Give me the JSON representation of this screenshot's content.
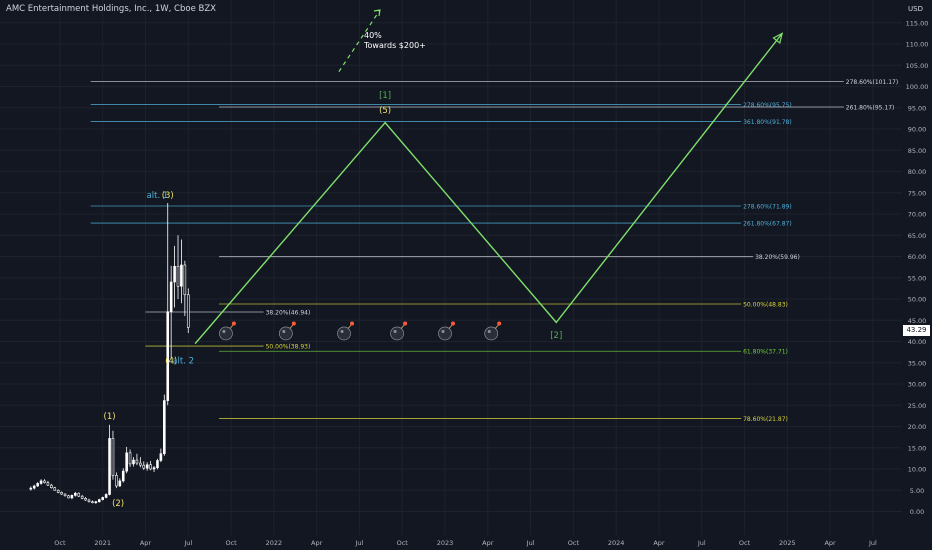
{
  "title": "AMC Entertainment Holdings, Inc., 1W, Cboe BZX",
  "currency": "USD",
  "last_price": "43.29",
  "annotation_lines": [
    "40%",
    "Towards $200+"
  ],
  "colors": {
    "background": "#131722",
    "grid": "#1e222d",
    "up": "#ffffff",
    "down": "#ffffff",
    "projection": "#7ee06a",
    "fib_cyan": "#4fb0d8",
    "fib_yellow": "#d6d43a",
    "fib_green": "#6fcf3a",
    "fib_white": "#d1d4dc",
    "wave_label": "#f0e36a",
    "alt_label": "#4fb0d8",
    "wave_bracket": "#54b054"
  },
  "chart_data": {
    "type": "candlestick",
    "title": "AMC Entertainment Holdings, Inc., 1W, Cboe BZX",
    "xlabel": "",
    "ylabel": "",
    "ylim": [
      -2,
      120
    ],
    "y_ticks": [
      "0.00",
      "5.00",
      "10.00",
      "15.00",
      "20.00",
      "25.00",
      "30.00",
      "35.00",
      "40.00",
      "45.00",
      "50.00",
      "55.00",
      "60.00",
      "65.00",
      "70.00",
      "75.00",
      "80.00",
      "85.00",
      "90.00",
      "95.00",
      "100.00",
      "105.00",
      "110.00",
      "115.00"
    ],
    "x_ticks": [
      {
        "label": "Oct",
        "t": 2020.75
      },
      {
        "label": "2021",
        "t": 2021.0
      },
      {
        "label": "Apr",
        "t": 2021.25
      },
      {
        "label": "Jul",
        "t": 2021.5
      },
      {
        "label": "Oct",
        "t": 2021.75
      },
      {
        "label": "2022",
        "t": 2022.0
      },
      {
        "label": "Apr",
        "t": 2022.25
      },
      {
        "label": "Jul",
        "t": 2022.5
      },
      {
        "label": "Oct",
        "t": 2022.75
      },
      {
        "label": "2023",
        "t": 2023.0
      },
      {
        "label": "Apr",
        "t": 2023.25
      },
      {
        "label": "Jul",
        "t": 2023.5
      },
      {
        "label": "Oct",
        "t": 2023.75
      },
      {
        "label": "2024",
        "t": 2024.0
      },
      {
        "label": "Apr",
        "t": 2024.25
      },
      {
        "label": "Jul",
        "t": 2024.5
      },
      {
        "label": "Oct",
        "t": 2024.75
      },
      {
        "label": "2025",
        "t": 2025.0
      },
      {
        "label": "Apr",
        "t": 2025.25
      },
      {
        "label": "Jul",
        "t": 2025.5
      }
    ],
    "candles": [
      {
        "t": 2020.58,
        "o": 5.3,
        "h": 5.9,
        "l": 4.9,
        "c": 5.5
      },
      {
        "t": 2020.6,
        "o": 5.5,
        "h": 6.3,
        "l": 5.2,
        "c": 6.0
      },
      {
        "t": 2020.62,
        "o": 6.0,
        "h": 6.9,
        "l": 5.8,
        "c": 6.6
      },
      {
        "t": 2020.64,
        "o": 6.6,
        "h": 7.6,
        "l": 6.3,
        "c": 7.2
      },
      {
        "t": 2020.66,
        "o": 7.2,
        "h": 7.6,
        "l": 6.6,
        "c": 6.8
      },
      {
        "t": 2020.68,
        "o": 6.8,
        "h": 7.2,
        "l": 6.0,
        "c": 6.2
      },
      {
        "t": 2020.7,
        "o": 6.2,
        "h": 6.5,
        "l": 5.4,
        "c": 5.6
      },
      {
        "t": 2020.72,
        "o": 5.6,
        "h": 5.8,
        "l": 4.9,
        "c": 5.0
      },
      {
        "t": 2020.74,
        "o": 5.0,
        "h": 5.2,
        "l": 4.3,
        "c": 4.5
      },
      {
        "t": 2020.76,
        "o": 4.5,
        "h": 4.7,
        "l": 3.9,
        "c": 4.1
      },
      {
        "t": 2020.78,
        "o": 4.1,
        "h": 4.3,
        "l": 3.5,
        "c": 3.7
      },
      {
        "t": 2020.8,
        "o": 3.7,
        "h": 3.9,
        "l": 3.1,
        "c": 3.2
      },
      {
        "t": 2020.82,
        "o": 3.2,
        "h": 4.0,
        "l": 2.9,
        "c": 3.8
      },
      {
        "t": 2020.84,
        "o": 3.8,
        "h": 4.6,
        "l": 3.5,
        "c": 4.3
      },
      {
        "t": 2020.86,
        "o": 4.3,
        "h": 4.5,
        "l": 3.4,
        "c": 3.6
      },
      {
        "t": 2020.88,
        "o": 3.6,
        "h": 3.9,
        "l": 2.9,
        "c": 3.1
      },
      {
        "t": 2020.9,
        "o": 3.1,
        "h": 3.4,
        "l": 2.5,
        "c": 2.7
      },
      {
        "t": 2020.92,
        "o": 2.7,
        "h": 3.0,
        "l": 2.1,
        "c": 2.3
      },
      {
        "t": 2020.94,
        "o": 2.3,
        "h": 2.6,
        "l": 1.9,
        "c": 2.1
      },
      {
        "t": 2020.96,
        "o": 2.1,
        "h": 2.5,
        "l": 1.8,
        "c": 2.3
      },
      {
        "t": 2020.98,
        "o": 2.3,
        "h": 3.0,
        "l": 2.1,
        "c": 2.8
      },
      {
        "t": 2021.0,
        "o": 2.8,
        "h": 3.5,
        "l": 2.6,
        "c": 3.3
      },
      {
        "t": 2021.02,
        "o": 3.3,
        "h": 4.3,
        "l": 3.1,
        "c": 4.0
      },
      {
        "t": 2021.04,
        "o": 4.0,
        "h": 20.4,
        "l": 3.8,
        "c": 17.2
      },
      {
        "t": 2021.06,
        "o": 17.2,
        "h": 19.0,
        "l": 7.5,
        "c": 8.5
      },
      {
        "t": 2021.08,
        "o": 8.5,
        "h": 9.2,
        "l": 5.5,
        "c": 6.0
      },
      {
        "t": 2021.1,
        "o": 6.0,
        "h": 7.8,
        "l": 5.8,
        "c": 7.2
      },
      {
        "t": 2021.12,
        "o": 7.2,
        "h": 10.2,
        "l": 6.8,
        "c": 9.5
      },
      {
        "t": 2021.14,
        "o": 9.5,
        "h": 15.2,
        "l": 9.0,
        "c": 13.8
      },
      {
        "t": 2021.16,
        "o": 13.8,
        "h": 14.6,
        "l": 10.5,
        "c": 11.2
      },
      {
        "t": 2021.18,
        "o": 11.2,
        "h": 12.8,
        "l": 10.6,
        "c": 12.1
      },
      {
        "t": 2021.2,
        "o": 12.1,
        "h": 13.6,
        "l": 10.9,
        "c": 11.4
      },
      {
        "t": 2021.22,
        "o": 11.4,
        "h": 12.8,
        "l": 10.4,
        "c": 10.9
      },
      {
        "t": 2021.24,
        "o": 10.9,
        "h": 11.8,
        "l": 9.8,
        "c": 10.2
      },
      {
        "t": 2021.26,
        "o": 10.2,
        "h": 11.6,
        "l": 9.6,
        "c": 11.0
      },
      {
        "t": 2021.28,
        "o": 11.0,
        "h": 11.9,
        "l": 9.7,
        "c": 10.0
      },
      {
        "t": 2021.3,
        "o": 10.0,
        "h": 10.7,
        "l": 9.3,
        "c": 10.3
      },
      {
        "t": 2021.32,
        "o": 10.3,
        "h": 12.4,
        "l": 9.9,
        "c": 12.0
      },
      {
        "t": 2021.34,
        "o": 12.0,
        "h": 14.8,
        "l": 11.6,
        "c": 13.6
      },
      {
        "t": 2021.36,
        "o": 13.6,
        "h": 27.5,
        "l": 13.1,
        "c": 26.1
      },
      {
        "t": 2021.38,
        "o": 26.1,
        "h": 72.6,
        "l": 25.0,
        "c": 47.0
      },
      {
        "t": 2021.4,
        "o": 47.0,
        "h": 57.8,
        "l": 36.0,
        "c": 54.0
      },
      {
        "t": 2021.42,
        "o": 54.0,
        "h": 62.5,
        "l": 48.0,
        "c": 57.7
      },
      {
        "t": 2021.44,
        "o": 57.7,
        "h": 65.0,
        "l": 50.0,
        "c": 53.0
      },
      {
        "t": 2021.46,
        "o": 53.0,
        "h": 64.0,
        "l": 49.0,
        "c": 58.0
      },
      {
        "t": 2021.48,
        "o": 58.0,
        "h": 59.0,
        "l": 46.0,
        "c": 51.0
      },
      {
        "t": 2021.5,
        "o": 51.0,
        "h": 52.5,
        "l": 42.0,
        "c": 43.3
      }
    ],
    "projection": [
      {
        "t": 2021.54,
        "v": 39.5
      },
      {
        "t": 2022.65,
        "v": 91.5
      },
      {
        "t": 2023.65,
        "v": 44.5
      },
      {
        "t": 2024.97,
        "v": 112.5
      }
    ],
    "projection_extension": [
      {
        "t": 2022.38,
        "v": 103.5
      },
      {
        "t": 2022.62,
        "v": 118.0
      }
    ],
    "levels": [
      {
        "value": 101.17,
        "label": "278.60%(101.17)",
        "t0": 2020.93,
        "t1": 2025.33,
        "color": "white"
      },
      {
        "value": 95.75,
        "label": "278.60%(95.75)",
        "t0": 2020.93,
        "t1": 2024.73,
        "color": "cyan"
      },
      {
        "value": 95.17,
        "label": "261.80%(95.17)",
        "t0": 2021.68,
        "t1": 2025.33,
        "color": "white"
      },
      {
        "value": 91.78,
        "label": "361.80%(91.78)",
        "t0": 2020.93,
        "t1": 2024.73,
        "color": "cyan"
      },
      {
        "value": 71.89,
        "label": "278.60%(71.89)",
        "t0": 2020.93,
        "t1": 2024.73,
        "color": "cyan"
      },
      {
        "value": 67.87,
        "label": "261.80%(67.87)",
        "t0": 2020.93,
        "t1": 2024.73,
        "color": "cyan"
      },
      {
        "value": 59.96,
        "label": "38.20%(59.96)",
        "t0": 2021.68,
        "t1": 2024.8,
        "color": "white"
      },
      {
        "value": 48.83,
        "label": "50.00%(48.83)",
        "t0": 2021.68,
        "t1": 2024.73,
        "color": "yellow"
      },
      {
        "value": 46.94,
        "label": "38.20%(46.94)",
        "t0": 2021.25,
        "t1": 2021.94,
        "color": "white"
      },
      {
        "value": 38.93,
        "label": "50.00%(38.93)",
        "t0": 2021.25,
        "t1": 2021.94,
        "color": "yellow"
      },
      {
        "value": 37.71,
        "label": "61.80%(37.71)",
        "t0": 2021.68,
        "t1": 2024.73,
        "color": "green"
      },
      {
        "value": 21.87,
        "label": "78.60%(21.87)",
        "t0": 2021.68,
        "t1": 2024.73,
        "color": "yellow"
      }
    ],
    "wave_labels": [
      {
        "text": "(1)",
        "t": 2021.04,
        "v": 22.5,
        "color": "yellow"
      },
      {
        "text": "(2)",
        "t": 2021.09,
        "v": 2.0,
        "color": "yellow"
      },
      {
        "text": "(3)",
        "t": 2021.38,
        "v": 74.5,
        "color": "yellow"
      },
      {
        "text": "(4)",
        "t": 2021.4,
        "v": 35.5,
        "color": "yellow"
      },
      {
        "text": "(5)",
        "t": 2022.65,
        "v": 94.5,
        "color": "yellow"
      },
      {
        "text": "[1]",
        "t": 2022.65,
        "v": 98.0,
        "color": "bracket"
      },
      {
        "text": "[2]",
        "t": 2023.65,
        "v": 41.5,
        "color": "bracket"
      },
      {
        "text": "alt. 1",
        "t": 2021.32,
        "v": 74.5,
        "color": "alt"
      },
      {
        "text": "alt. 2",
        "t": 2021.47,
        "v": 35.5,
        "color": "alt"
      }
    ],
    "bombs": [
      {
        "t": 2021.72,
        "v": 43.3
      },
      {
        "t": 2022.07,
        "v": 43.3
      },
      {
        "t": 2022.41,
        "v": 43.3
      },
      {
        "t": 2022.72,
        "v": 43.3
      },
      {
        "t": 2023.0,
        "v": 43.3
      },
      {
        "t": 2023.27,
        "v": 43.3
      }
    ]
  }
}
